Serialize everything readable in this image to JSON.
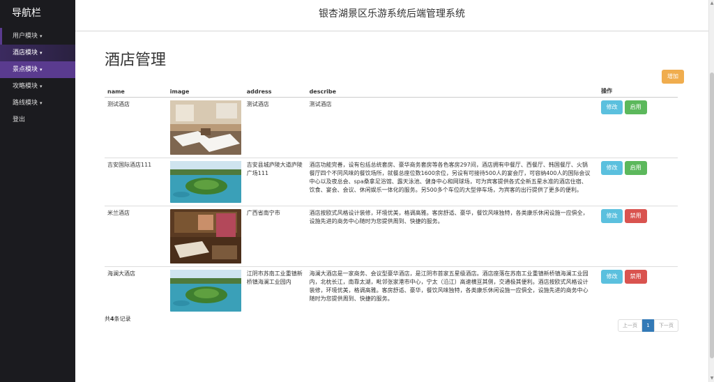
{
  "sidebar": {
    "title": "导航栏",
    "items": [
      {
        "label": "用户模块",
        "caret": "▾"
      },
      {
        "label": "酒店模块",
        "caret": "▾"
      },
      {
        "label": "景点模块",
        "caret": "▾"
      },
      {
        "label": "攻略模块",
        "caret": "▾"
      },
      {
        "label": "路线模块",
        "caret": "▾"
      },
      {
        "label": "登出",
        "caret": ""
      }
    ]
  },
  "header": {
    "title": "银杏湖景区乐游系统后端管理系统"
  },
  "page": {
    "title": "酒店管理",
    "add_button": "增加"
  },
  "table": {
    "columns": [
      "name",
      "image",
      "address",
      "describe",
      "操作"
    ],
    "rows": [
      {
        "name": "测试酒店",
        "image": "room-twin-beds",
        "address": "测试酒店",
        "describe": "测试酒店",
        "edit": "修改",
        "toggle": "启用",
        "toggle_color": "#5cb85c"
      },
      {
        "name": "吉安国际酒店111",
        "image": "lake-island-aerial",
        "address": "吉安县城庐陵大道庐陵广场111",
        "describe": "酒店功能完善，设有包括总统套房、豪华商务套房等各色客房297间，酒店拥有中餐厅、西餐厅、韩国餐厅、火锅餐厅四个不同风味的餐饮场所，就餐总座位数1600余位，另设有可接待500人的宴会厅，可容纳400人的国际会议中心以及夜总会、spa桑拿足浴馆、露天泳池、健身中心和网球场，可为宾客提供各式全新五星水准的酒店住宿、饮食、宴会、会议、休闲娱乐一体化的服务。另500多个车位的大型停车场，为宾客的出行提供了更多的便利。",
        "edit": "修改",
        "toggle": "启用",
        "toggle_color": "#5cb85c"
      },
      {
        "name": "米兰酒店",
        "image": "room-wood-interior",
        "address": "广西省南宁市",
        "describe": "酒店按欧式风格设计装修，环境优美，格调高雅。客房舒适、豪华，餐饮风味独特，各类康乐休闲设施一应俱全，设施先进的商务中心随时为您提供周到、快捷的服务。",
        "edit": "修改",
        "toggle": "禁用",
        "toggle_color": "#d9534f"
      },
      {
        "name": "海澜大酒店",
        "image": "lake-island-aerial",
        "address": "江阴市苏南工业重镇新桥镇海澜工业园内",
        "describe": "海澜大酒店是一家商务、会议型豪华酒店，是江阴市首家五星级酒店。酒店座落在苏南工业重镇新桥镇海澜工业园内，北枕长江，南靠太湖，毗邻张家港市中心，宁太（沿江）高速横亘其侧，交通极其便利。酒店按欧式风格设计装修，环境优美，格调高雅。客房舒适、豪华，餐饮风味独特，各类康乐休闲设施一应俱全，设施先进的商务中心随时为您提供周到、快捷的服务。",
        "edit": "修改",
        "toggle": "禁用",
        "toggle_color": "#d9534f"
      }
    ]
  },
  "footer": {
    "total_prefix": "共",
    "total_count": "4",
    "total_suffix": "条记录"
  },
  "pager": {
    "prev": "上一页",
    "current": "1",
    "next": "下一页"
  }
}
